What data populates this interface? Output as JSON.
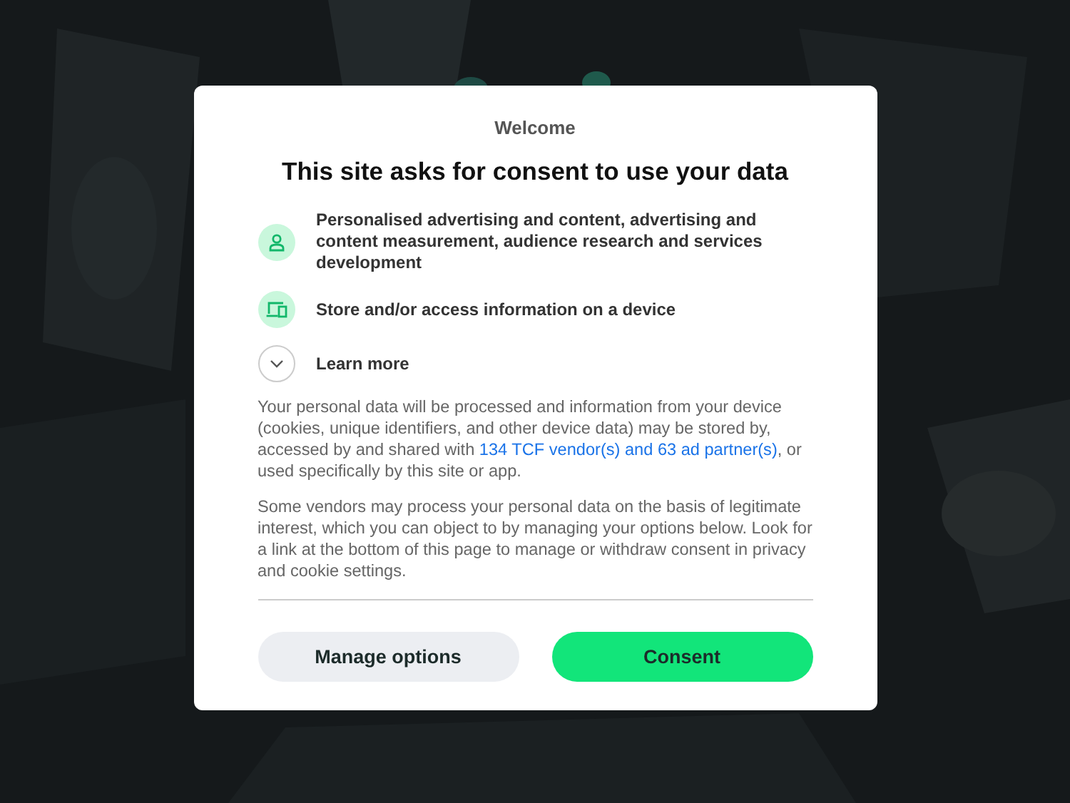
{
  "dialog": {
    "kicker": "Welcome",
    "title": "This site asks for consent to use your data",
    "purposes": [
      {
        "kind": "person",
        "label": "Personalised advertising and content, advertising and content measurement, audience research and services development"
      },
      {
        "kind": "device",
        "label": "Store and/or access information on a device"
      }
    ],
    "learn_more": {
      "label": "Learn more",
      "expanded": false
    },
    "paragraphs": [
      {
        "before": "Your personal data will be processed and information from your device (cookies, unique identifiers, and other device data) may be stored by, accessed by and shared with ",
        "link": "134 TCF vendor(s) and 63 ad partner(s)",
        "after": ", or used specifically by this site or app."
      },
      {
        "before": "Some vendors may process your personal data on the basis of legitimate interest, which you can object to by managing your options below. Look for a link at the bottom of this page to manage or withdraw consent in privacy and cookie settings."
      }
    ],
    "buttons": [
      {
        "kind": "secondary",
        "label": "Manage options"
      },
      {
        "kind": "primary",
        "label": "Consent"
      }
    ]
  }
}
